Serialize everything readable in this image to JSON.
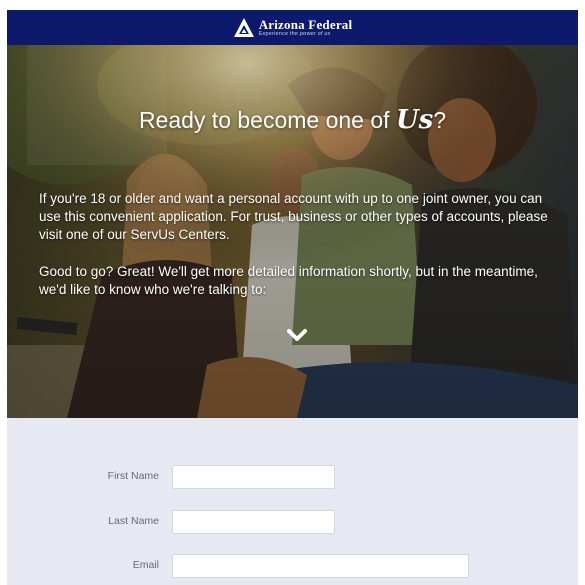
{
  "header": {
    "brand_name": "Arizona Federal",
    "tagline_prefix": "Experience the",
    "tagline_em": "power of us",
    "bg_color": "#0d1a6b"
  },
  "hero": {
    "title_prefix": "Ready to become one of",
    "title_us": "Us",
    "title_suffix": "?",
    "paragraph_1": "If you're 18 or older and want a personal account with up to one joint owner, you can use this convenient application. For trust, business or other types of accounts, please visit one of our ServUs Centers.",
    "paragraph_2": "Good to go? Great! We'll get more detailed information shortly, but in the meantime, we'd like to know who we're talking to:",
    "scroll_icon": "chevron-down-icon"
  },
  "form": {
    "fields": [
      {
        "label": "First Name",
        "value": "",
        "placeholder": ""
      },
      {
        "label": "Last Name",
        "value": "",
        "placeholder": ""
      },
      {
        "label": "Email",
        "value": "",
        "placeholder": ""
      }
    ],
    "bg_color": "#e6e9f1"
  }
}
